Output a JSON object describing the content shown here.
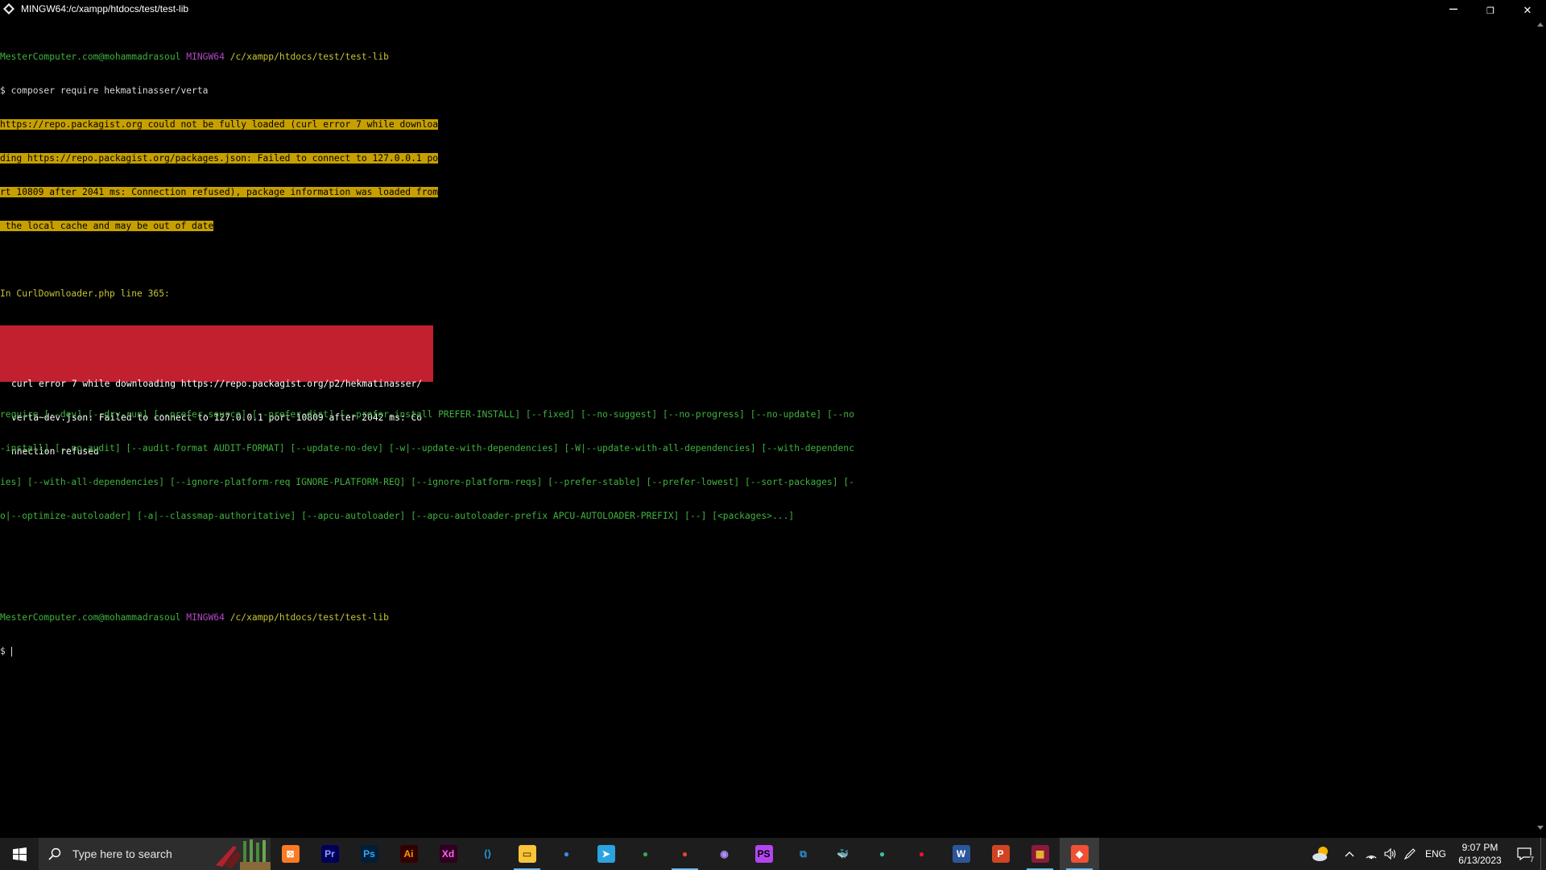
{
  "window": {
    "title": "MINGW64:/c/xampp/htdocs/test/test-lib",
    "controls": {
      "minimize": "─",
      "maximize": "❐",
      "close": "✕"
    }
  },
  "terminal": {
    "prompt1": {
      "user": "MesterComputer.com@mohammadrasoul",
      "env": "MINGW64",
      "path": "/c/xampp/htdocs/test/test-lib"
    },
    "command": "$ composer require hekmatinasser/verta",
    "warning_lines": [
      "https://repo.packagist.org could not be fully loaded (curl error 7 while downloa",
      "ding https://repo.packagist.org/packages.json: Failed to connect to 127.0.0.1 po",
      "rt 10809 after 2041 ms: Connection refused), package information was loaded from",
      " the local cache and may be out of date"
    ],
    "error_location": "In CurlDownloader.php line 365:",
    "error_lines": [
      "curl error 7 while downloading https://repo.packagist.org/p2/hekmatinasser/",
      "verta~dev.json: Failed to connect to 127.0.0.1 port 10809 after 2042 ms: Co",
      "nnection refused"
    ],
    "usage_lines": [
      "require [--dev] [--dry-run] [--prefer-source] [--prefer-dist] [--prefer-install PREFER-INSTALL] [--fixed] [--no-suggest] [--no-progress] [--no-update] [--no",
      "-install] [--no-audit] [--audit-format AUDIT-FORMAT] [--update-no-dev] [-w|--update-with-dependencies] [-W|--update-with-all-dependencies] [--with-dependenc",
      "ies] [--with-all-dependencies] [--ignore-platform-req IGNORE-PLATFORM-REQ] [--ignore-platform-reqs] [--prefer-stable] [--prefer-lowest] [--sort-packages] [-",
      "o|--optimize-autoloader] [-a|--classmap-authoritative] [--apcu-autoloader] [--apcu-autoloader-prefix APCU-AUTOLOADER-PREFIX] [--] [<packages>...]"
    ],
    "prompt2": {
      "user": "MesterComputer.com@mohammadrasoul",
      "env": "MINGW64",
      "path": "/c/xampp/htdocs/test/test-lib"
    },
    "input_prompt": "$ "
  },
  "taskbar": {
    "search_placeholder": "Type here to search",
    "apps": [
      {
        "name": "xampp",
        "label": "⊠",
        "bg": "#fb7a24",
        "fg": "#ffffff"
      },
      {
        "name": "premiere",
        "label": "Pr",
        "bg": "#00005b",
        "fg": "#9999ff"
      },
      {
        "name": "photoshop",
        "label": "Ps",
        "bg": "#001e36",
        "fg": "#31a8ff"
      },
      {
        "name": "illustrator",
        "label": "Ai",
        "bg": "#330000",
        "fg": "#ff9a00"
      },
      {
        "name": "xd",
        "label": "Xd",
        "bg": "#2e001e",
        "fg": "#ff61f6"
      },
      {
        "name": "vscode",
        "label": "⟨⟩",
        "bg": "#1d1d1d",
        "fg": "#23a9f2"
      },
      {
        "name": "file-explorer",
        "label": "▭",
        "bg": "#f8c43a",
        "fg": "#7a5600"
      },
      {
        "name": "chrome",
        "label": "●",
        "bg": "#1d1d1d",
        "fg": "#4285f4"
      },
      {
        "name": "telegram",
        "label": "➤",
        "bg": "#2aa3e0",
        "fg": "#ffffff"
      },
      {
        "name": "chrome-profile-1",
        "label": "●",
        "bg": "#1d1d1d",
        "fg": "#34a853"
      },
      {
        "name": "chrome-profile-2",
        "label": "●",
        "bg": "#1d1d1d",
        "fg": "#ea4335"
      },
      {
        "name": "github",
        "label": "◉",
        "bg": "#1d1d1d",
        "fg": "#b08cff"
      },
      {
        "name": "phpstorm",
        "label": "PS",
        "bg": "#b345f1",
        "fg": "#000000"
      },
      {
        "name": "copy-app",
        "label": "⧉",
        "bg": "#1d1d1d",
        "fg": "#2c8ed6"
      },
      {
        "name": "docker",
        "label": "🐳",
        "bg": "#1d1d1d",
        "fg": "#2496ed"
      },
      {
        "name": "edge-orb",
        "label": "●",
        "bg": "#1d1d1d",
        "fg": "#35c0a5"
      },
      {
        "name": "recorder",
        "label": "●",
        "bg": "#1d1d1d",
        "fg": "#e01b24"
      },
      {
        "name": "word",
        "label": "W",
        "bg": "#2b579a",
        "fg": "#ffffff"
      },
      {
        "name": "powerpoint",
        "label": "P",
        "bg": "#d04423",
        "fg": "#ffffff"
      },
      {
        "name": "winrar",
        "label": "▦",
        "bg": "#8b1a3a",
        "fg": "#f0c030"
      },
      {
        "name": "git-bash",
        "label": "◆",
        "bg": "#f05033",
        "fg": "#ffffff"
      }
    ],
    "tray": {
      "language": "ENG",
      "time": "9:07 PM",
      "date": "6/13/2023",
      "notification_count": "7"
    }
  }
}
